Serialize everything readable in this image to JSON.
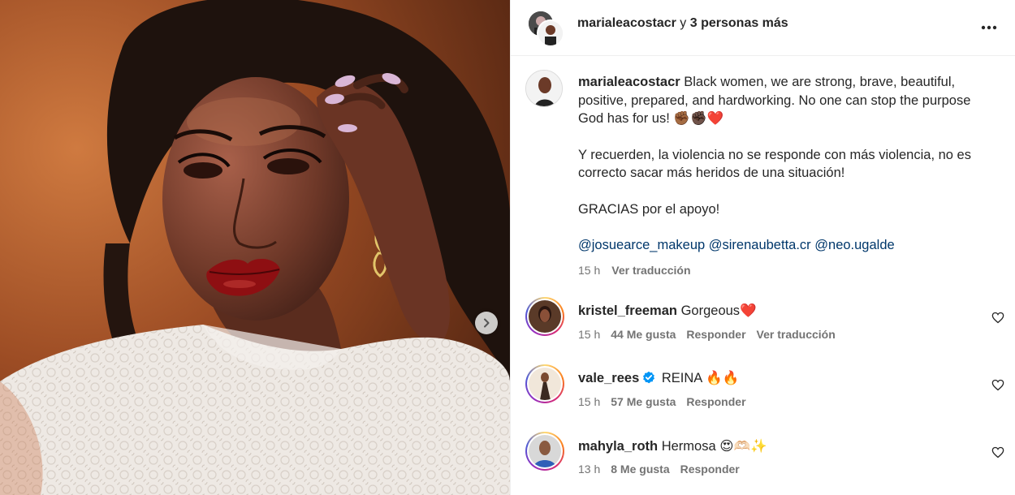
{
  "header": {
    "username": "marialeacostacr",
    "connector": " y ",
    "others": "3 personas más"
  },
  "caption": {
    "username": "marialeacostacr",
    "paragraph1": "Black women, we are strong, brave, beautiful, positive, prepared, and hardworking. No one can stop the purpose God has for us! ✊🏾✊🏿❤️",
    "paragraph2": "Y recuerden, la violencia no se responde con más violencia, no es correcto sacar más heridos de una situación!",
    "paragraph3": "GRACIAS por el apoyo!",
    "mentions": [
      "@josuearce_makeup",
      "@sirenaubetta.cr",
      "@neo.ugalde"
    ],
    "time": "15 h",
    "translate": "Ver traducción"
  },
  "comments": [
    {
      "username": "kristel_freeman",
      "text": "Gorgeous❤️",
      "verified": false,
      "time": "15 h",
      "likes": "44 Me gusta",
      "reply": "Responder",
      "translate": "Ver traducción"
    },
    {
      "username": "vale_rees",
      "text": "REINA 🔥🔥",
      "verified": true,
      "time": "15 h",
      "likes": "57 Me gusta",
      "reply": "Responder"
    },
    {
      "username": "mahyla_roth",
      "text": "Hermosa 😍🫶🏻✨",
      "verified": false,
      "time": "13 h",
      "likes": "8 Me gusta",
      "reply": "Responder"
    }
  ],
  "icons": {
    "more": "more-options-icon",
    "next": "chevron-right-icon",
    "like": "heart-outline-icon",
    "verified": "verified-badge-icon"
  },
  "colors": {
    "mention": "#00376b",
    "muted": "#737373",
    "verified": "#0095f6"
  }
}
